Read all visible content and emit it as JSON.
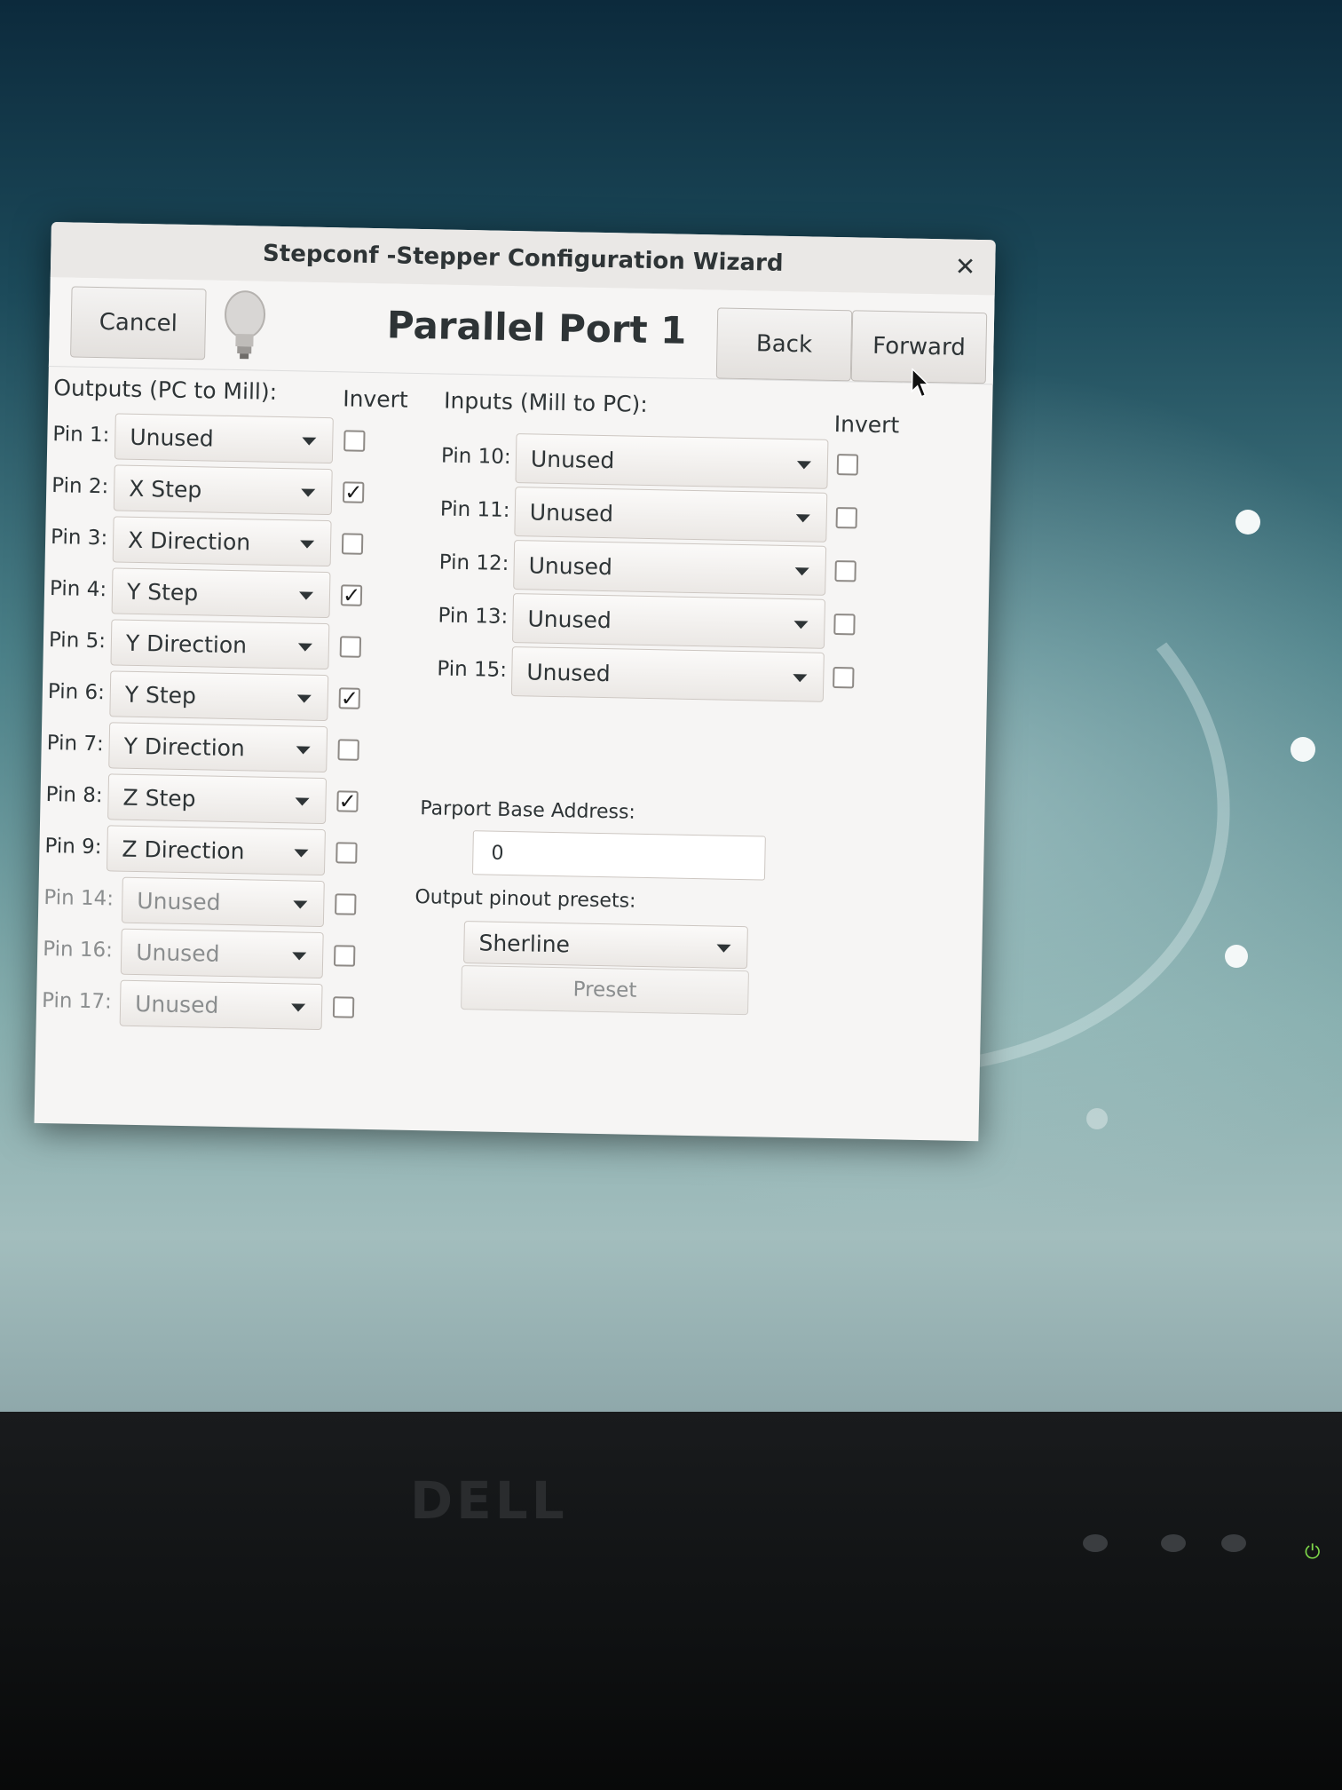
{
  "window": {
    "title": "Stepconf -Stepper Configuration Wizard"
  },
  "header": {
    "cancel": "Cancel",
    "heading": "Parallel Port 1",
    "back": "Back",
    "forward": "Forward"
  },
  "outputs": {
    "label": "Outputs (PC to Mill):",
    "invert_label": "Invert",
    "rows": [
      {
        "pin": "Pin 1:",
        "value": "Unused",
        "invert": false
      },
      {
        "pin": "Pin 2:",
        "value": "X Step",
        "invert": true
      },
      {
        "pin": "Pin 3:",
        "value": "X Direction",
        "invert": false
      },
      {
        "pin": "Pin 4:",
        "value": "Y Step",
        "invert": true
      },
      {
        "pin": "Pin 5:",
        "value": "Y Direction",
        "invert": false
      },
      {
        "pin": "Pin 6:",
        "value": "Y Step",
        "invert": true
      },
      {
        "pin": "Pin 7:",
        "value": "Y Direction",
        "invert": false
      },
      {
        "pin": "Pin 8:",
        "value": "Z Step",
        "invert": true
      },
      {
        "pin": "Pin 9:",
        "value": "Z Direction",
        "invert": false
      },
      {
        "pin": "Pin 14:",
        "value": "Unused",
        "invert": false
      },
      {
        "pin": "Pin 16:",
        "value": "Unused",
        "invert": false
      },
      {
        "pin": "Pin 17:",
        "value": "Unused",
        "invert": false
      }
    ]
  },
  "inputs": {
    "label": "Inputs (Mill to PC):",
    "invert_label": "Invert",
    "rows": [
      {
        "pin": "Pin 10:",
        "value": "Unused",
        "invert": false
      },
      {
        "pin": "Pin 11:",
        "value": "Unused",
        "invert": false
      },
      {
        "pin": "Pin 12:",
        "value": "Unused",
        "invert": false
      },
      {
        "pin": "Pin 13:",
        "value": "Unused",
        "invert": false
      },
      {
        "pin": "Pin 15:",
        "value": "Unused",
        "invert": false
      }
    ]
  },
  "parport": {
    "address_label": "Parport Base Address:",
    "address_value": "0",
    "presets_label": "Output pinout presets:",
    "preset_selected": "Sherline",
    "preset_button": "Preset"
  },
  "monitor": {
    "brand": "DELL"
  },
  "colors": {
    "dialog_bg": "#f6f5f4",
    "desktop": "#4b8088",
    "power_led": "#7fd94a"
  }
}
